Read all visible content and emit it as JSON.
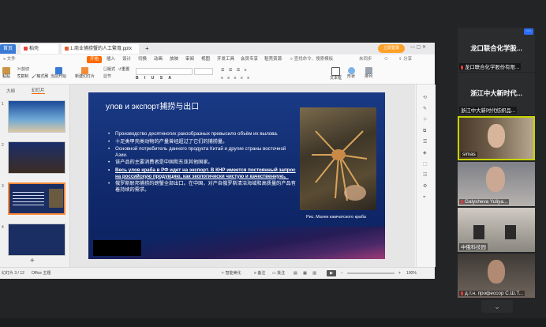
{
  "tabs": [
    {
      "label": "首页"
    },
    {
      "label": "稻壳"
    },
    {
      "label": "1.商业捕捞蟹的人工繁育.pptx"
    }
  ],
  "login_button": "立即登录",
  "menu": {
    "start": "开始",
    "items": [
      "插入",
      "设计",
      "切换",
      "动画",
      "放映",
      "审阅",
      "视图",
      "开发工具",
      "会员专享",
      "稻壳资源"
    ],
    "search": "查找命令、搜索模板",
    "collab": "未同步",
    "share": "分享"
  },
  "toolbar": {
    "paste": "粘贴",
    "cut": "剪切",
    "copy": "复制",
    "format_painter": "格式刷",
    "from_current": "当前开始",
    "new_slide": "新建幻灯片",
    "layout": "版式",
    "section": "节",
    "reset": "重置",
    "textbox": "文本框",
    "shape": "形状",
    "arrange": "排列"
  },
  "left_panel": {
    "tab_outline": "大纲",
    "tab_slides": "幻灯片",
    "numbers": [
      "1",
      "2",
      "3",
      "4"
    ],
    "add": "+"
  },
  "slide": {
    "title": "улов и экспорт捕捞与出口",
    "bullets": [
      {
        "text": "Производство десятиногих ракообразных превысило объём их вылова.",
        "bold": false
      },
      {
        "text": "十足类甲壳类动物的产量曾经超过了它们的捕捞量。",
        "bold": false
      },
      {
        "text": "Основной потребитель данного продукта Китай и другие страны восточной Азии.",
        "bold": false
      },
      {
        "text": "该产品的主要消费者是中国和东亚其他国家。",
        "bold": false
      },
      {
        "text": "Весь улов краба в РФ идет на экспорт. В КНР имеется постоянный запрос на российскую продукцию, как экологически чистую и качественную。",
        "bold": true
      },
      {
        "text": "俄罗斯联邦捕捞的螃蟹全部出口。在中国，对产自俄罗斯清洁海域和高质量的产品有着持续的需求。",
        "bold": false
      }
    ],
    "caption": "Рис.  Малек камчатского краба"
  },
  "statusbar": {
    "page": "幻灯片 3 / 12",
    "theme": "Office 主题",
    "smart": "智能美化",
    "notes": "备注",
    "comments": "批注",
    "zoom": "100%"
  },
  "participants": [
    {
      "big": "龙口联合化学股...",
      "label": "龙口联合化学股份有限..."
    },
    {
      "big": "浙江中大新时代...",
      "label": "浙江中大新时代纺织品..."
    },
    {
      "label": "simas"
    },
    {
      "label": "Galysheva Yuliya..."
    },
    {
      "label": "中俄科技园"
    },
    {
      "label": "д.т.н. профессор С.Ш.Т..."
    }
  ],
  "colors": {
    "accent": "#ff6a00",
    "slide_bg": "#133078",
    "active_speaker": "#c8d400"
  }
}
